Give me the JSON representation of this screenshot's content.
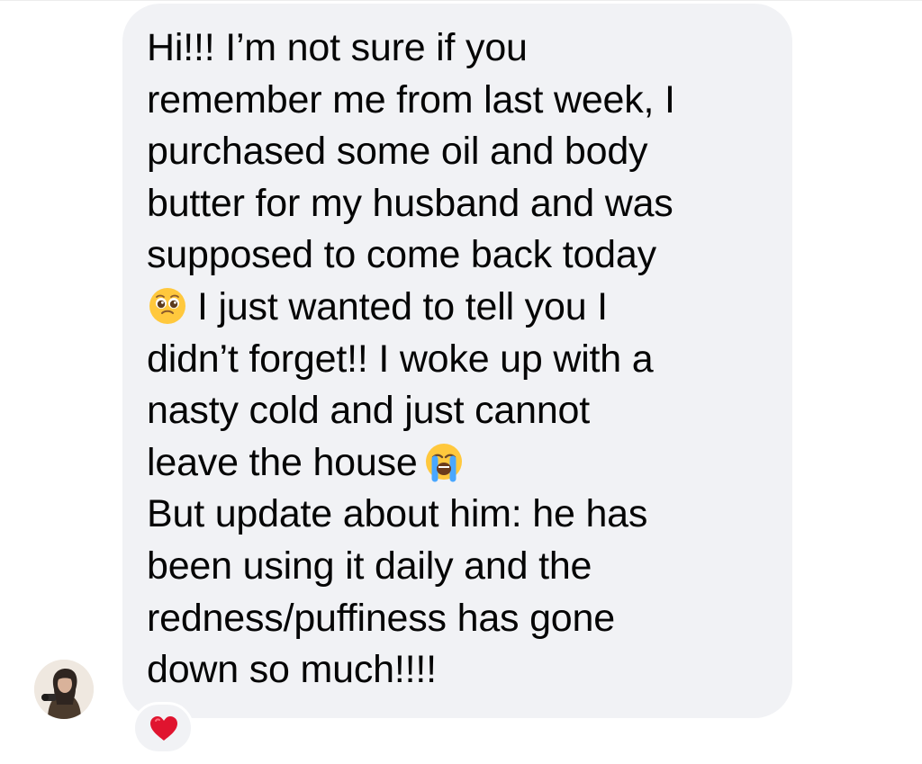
{
  "message": {
    "line_1": "Hi!!! I’m not sure if you",
    "line_2": "remember me from last week, I",
    "line_3": "purchased some oil and body",
    "line_4": "butter for my husband and was",
    "line_5": "supposed to come back today",
    "line_6": "I just wanted to tell you I",
    "line_7": "didn’t forget!! I woke up with a",
    "line_8": "nasty cold and just cannot",
    "line_9": "leave the house",
    "line_10": "But update about him: he has",
    "line_11": "been using it daily and the",
    "line_12": "redness/puffiness has gone",
    "line_13": "down so much!!!!"
  },
  "emoji": {
    "first": "pleading-face-emoji",
    "second": "loudly-crying-face-emoji"
  },
  "reaction": {
    "icon": "red-heart-icon",
    "color": "#e0142f"
  },
  "avatar": {
    "icon": "user-avatar-photo"
  },
  "colors": {
    "bubble": "#f1f2f5",
    "text": "#050505",
    "background": "#ffffff"
  }
}
